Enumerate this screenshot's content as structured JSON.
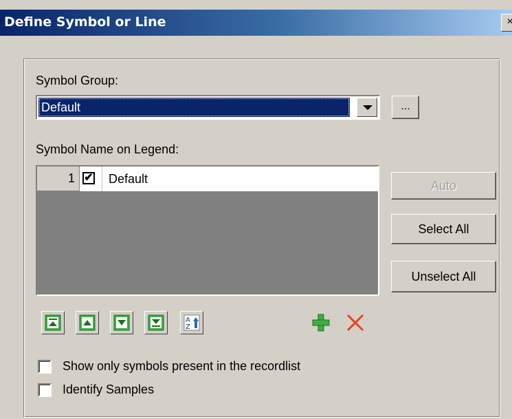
{
  "window": {
    "title": "Define Symbol or Line",
    "close_glyph": "×"
  },
  "symbol_group": {
    "label": "Symbol Group:",
    "selected": "Default",
    "browse_label": "..."
  },
  "legend": {
    "label": "Symbol Name on Legend:",
    "rows": [
      {
        "index": "1",
        "checked": true,
        "check_glyph": "✔",
        "name": "Default"
      }
    ]
  },
  "buttons": {
    "auto": "Auto",
    "select_all": "Select All",
    "unselect_all": "Unselect All"
  },
  "toolbar": {
    "icons": [
      "move-to-top-icon",
      "move-up-icon",
      "move-down-icon",
      "move-to-bottom-icon",
      "sort-az-icon",
      "add-icon",
      "delete-icon"
    ],
    "sort_glyph_top": "A",
    "sort_glyph_bottom": "Z"
  },
  "options": {
    "show_only_present": {
      "label": "Show only symbols present in the recordlist",
      "checked": false
    },
    "identify_samples": {
      "label": "Identify Samples",
      "checked": false
    }
  },
  "colors": {
    "title_start": "#0a246a",
    "title_end": "#a6caf0",
    "accent_green": "#3cb043",
    "delete_red": "#e8441c"
  }
}
